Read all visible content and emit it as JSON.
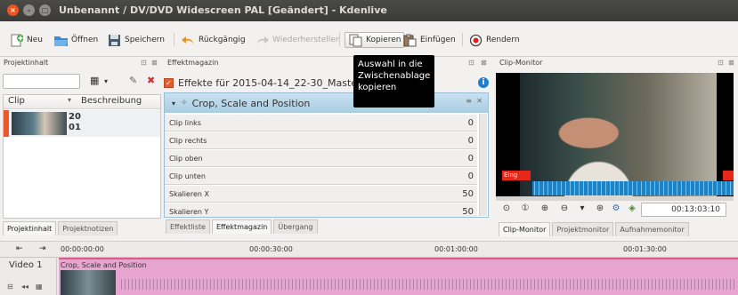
{
  "window": {
    "title": "Unbenannt / DV/DVD Widescreen PAL [Geändert] - Kdenlive",
    "close_glyph": "×",
    "minimize_glyph": "–",
    "maximize_glyph": "□"
  },
  "toolbar": {
    "new": "Neu",
    "open": "Öffnen",
    "save": "Speichern",
    "undo": "Rückgängig",
    "redo": "Wiederherstellen",
    "copy": "Kopieren",
    "paste": "Einfügen",
    "render": "Rendern"
  },
  "tooltip": {
    "text": "Auswahl in die Zwischenablage kopieren"
  },
  "project_bin": {
    "header": "Projektinhalt",
    "columns": [
      "Clip",
      "Beschreibung"
    ],
    "clip": {
      "line1": "20",
      "line2": "01"
    },
    "tabs": [
      "Projektinhalt",
      "Projektnotizen"
    ]
  },
  "effect_stack": {
    "header": "Effektmagazin",
    "title": "Effekte für 2015-04-14_22-30_Maste",
    "effect_name": "Crop, Scale and Position",
    "params": [
      {
        "label": "Clip links",
        "value": "0"
      },
      {
        "label": "Clip rechts",
        "value": "0"
      },
      {
        "label": "Clip oben",
        "value": "0"
      },
      {
        "label": "Clip unten",
        "value": "0"
      },
      {
        "label": "Skalieren X",
        "value": "50"
      },
      {
        "label": "Skalieren Y",
        "value": "50"
      }
    ],
    "tabs": [
      "Effektliste",
      "Effektmagazin",
      "Übergang"
    ]
  },
  "clip_monitor": {
    "header": "Clip-Monitor",
    "timecode": "00:13:03:10",
    "red_label": "Eing",
    "tabs": [
      "Clip-Monitor",
      "Projektmonitor",
      "Aufnahmemonitor"
    ]
  },
  "timeline": {
    "ticks": [
      "00:00:00:00",
      "00:00:30:00",
      "00:01:00:00",
      "00:01:30:00"
    ],
    "track_name": "Video 1",
    "clip_label": "Crop, Scale and Position"
  },
  "colors": {
    "accent": "#e8592b",
    "effect_header": "#b5d6ea",
    "timeline_clip": "#e8a5cf",
    "monitor_wave": "#1b84c9"
  }
}
